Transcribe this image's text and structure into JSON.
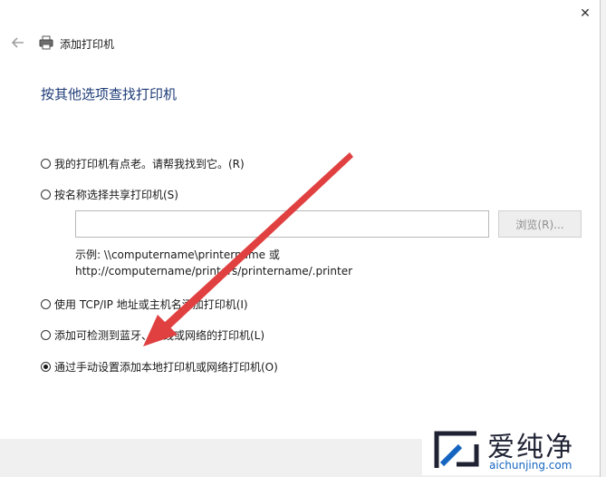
{
  "window": {
    "close_glyph": "✕"
  },
  "header": {
    "back_icon": "back-arrow-icon",
    "printer_icon": "printer-icon",
    "title": "添加打印机"
  },
  "page": {
    "title": "按其他选项查找打印机"
  },
  "options": [
    {
      "label": "我的打印机有点老。请帮我找到它。(R)",
      "checked": false
    },
    {
      "label": "按名称选择共享打印机(S)",
      "checked": false
    },
    {
      "label": "使用 TCP/IP 地址或主机名添加打印机(I)",
      "checked": false
    },
    {
      "label": "添加可检测到蓝牙、无线或网络的打印机(L)",
      "checked": false
    },
    {
      "label": "通过手动设置添加本地打印机或网络打印机(O)",
      "checked": true
    }
  ],
  "share": {
    "input_value": "",
    "browse_label": "浏览(R)...",
    "example_line1": "示例: \\\\computername\\printername 或",
    "example_line2": "http://computername/printers/printername/.printer"
  },
  "watermark": {
    "brand": "爱纯净",
    "url": "aichunjing.com"
  },
  "colors": {
    "accent": "#1e3c78",
    "arrow": "#e04040"
  }
}
